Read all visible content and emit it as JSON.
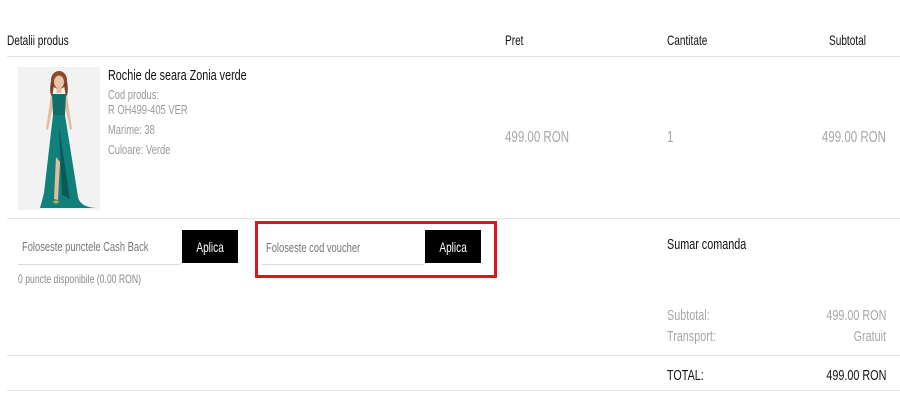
{
  "table": {
    "headers": {
      "product": "Detalii produs",
      "price": "Pret",
      "quantity": "Cantitate",
      "subtotal": "Subtotal"
    }
  },
  "product": {
    "name": "Rochie de seara Zonia verde",
    "code_label": "Cod produs:",
    "code_value": "R OH499-405 VER",
    "size": "Marime: 38",
    "color": "Culoare: Verde",
    "price": "499.00 RON",
    "quantity": "1",
    "subtotal": "499.00 RON",
    "image_alt": "green-evening-dress-photo"
  },
  "cashback": {
    "placeholder": "Foloseste punctele Cash Back",
    "button_label": "Aplica",
    "available": "0 puncte disponibile (0.00 RON)"
  },
  "voucher": {
    "placeholder": "Foloseste cod voucher",
    "button_label": "Aplica",
    "highlight_color": "#e0141f"
  },
  "summary": {
    "title": "Sumar comanda",
    "subtotal_label": "Subtotal:",
    "subtotal_value": "499.00 RON",
    "transport_label": "Transport:",
    "transport_value": "Gratuit",
    "total_label": "TOTAL:",
    "total_value": "499.00 RON"
  }
}
